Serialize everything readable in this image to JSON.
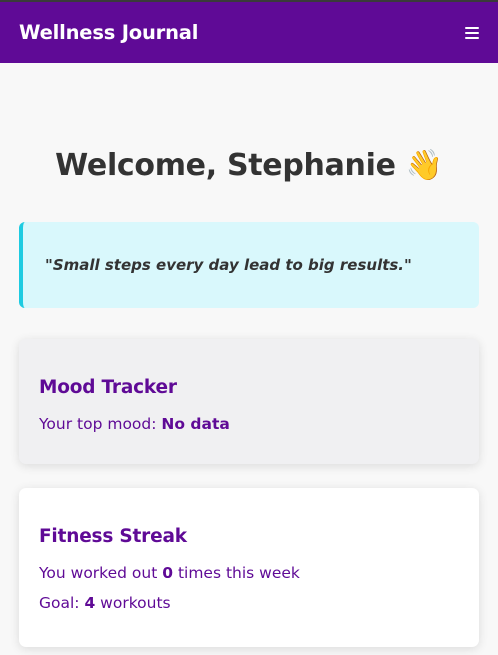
{
  "navbar": {
    "title": "Wellness Journal",
    "menu_icon": "hamburger-menu-icon"
  },
  "welcome": {
    "text": "Welcome, Stephanie 👋"
  },
  "quote": {
    "text": "\"Small steps every day lead to big results.\""
  },
  "mood_tracker": {
    "title": "Mood Tracker",
    "label": "Your top mood: ",
    "value": "No data"
  },
  "fitness_streak": {
    "title": "Fitness Streak",
    "prefix": "You worked out ",
    "count": "0",
    "suffix": " times this week",
    "goal_label": "Goal: ",
    "goal_value": "4",
    "goal_suffix": " workouts"
  },
  "colors": {
    "accent": "#5f0a96",
    "quote_bg": "#d9f8fc",
    "quote_border": "#1ecbe1"
  }
}
